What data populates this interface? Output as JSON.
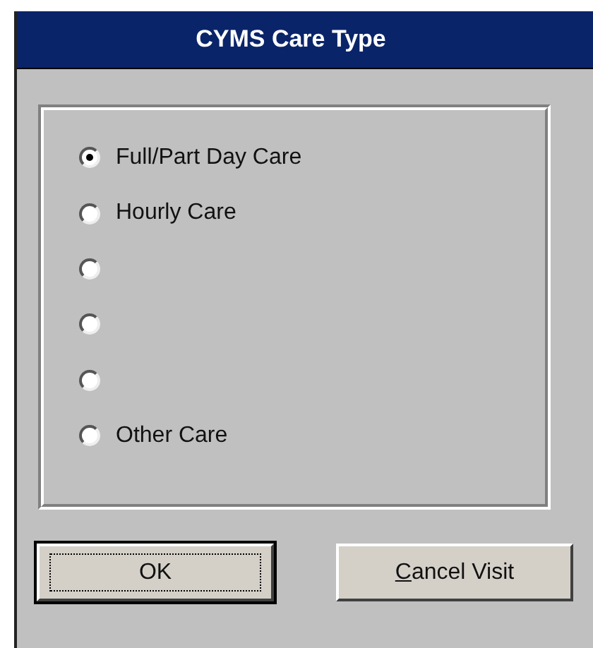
{
  "window": {
    "title": "CYMS Care Type"
  },
  "options": [
    {
      "label": "Full/Part Day Care",
      "selected": true
    },
    {
      "label": "Hourly Care",
      "selected": false
    },
    {
      "selected": false
    },
    {
      "selected": false
    },
    {
      "selected": false
    },
    {
      "label": "Other Care",
      "selected": false
    }
  ],
  "buttons": [
    {
      "label": "OK",
      "default": true
    },
    {
      "label": "Cancel Visit",
      "default": false,
      "first_letter_underlined": true
    }
  ]
}
